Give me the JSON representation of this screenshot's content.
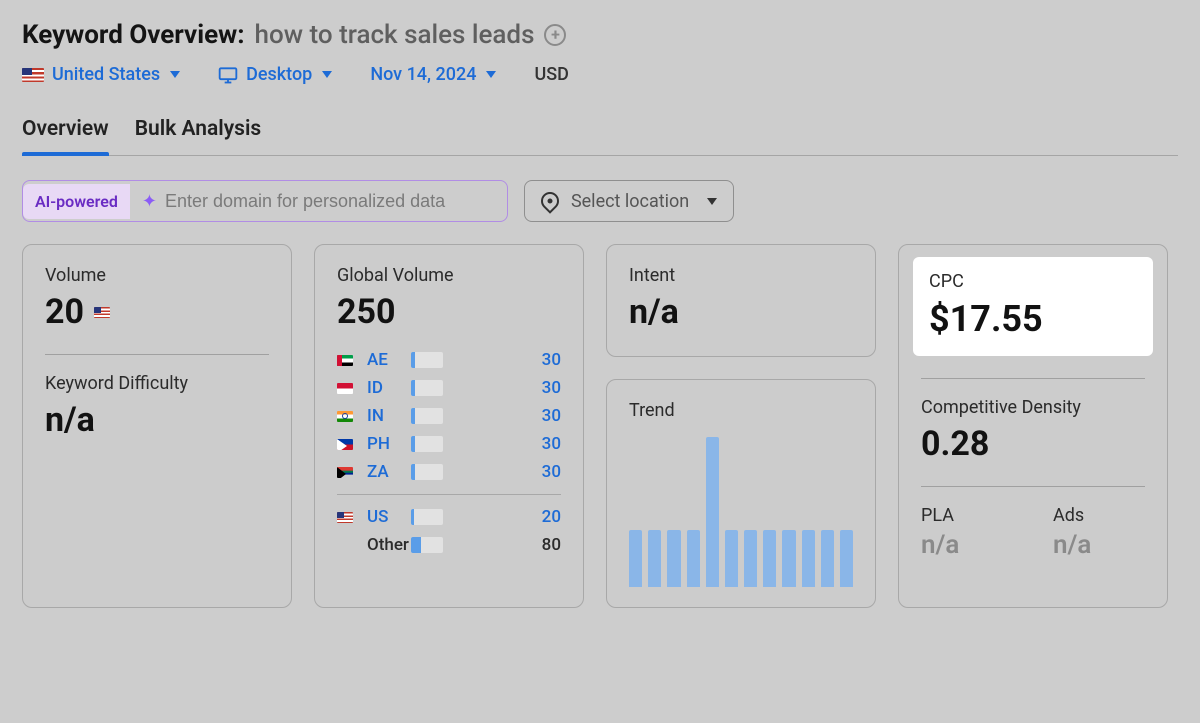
{
  "header": {
    "title_prefix": "Keyword Overview:",
    "keyword": "how to track sales leads"
  },
  "filters": {
    "country": "United States",
    "device": "Desktop",
    "date": "Nov 14, 2024",
    "currency": "USD"
  },
  "tabs": {
    "overview": "Overview",
    "bulk": "Bulk Analysis"
  },
  "controls": {
    "ai_badge": "AI-powered",
    "domain_placeholder": "Enter domain for personalized data",
    "location_placeholder": "Select location"
  },
  "cards": {
    "volume": {
      "label": "Volume",
      "value": "20"
    },
    "kd": {
      "label": "Keyword Difficulty",
      "value": "n/a"
    },
    "global_volume": {
      "label": "Global Volume",
      "value": "250",
      "rows": [
        {
          "flag": "ae",
          "code": "AE",
          "value": "30",
          "pct": 12
        },
        {
          "flag": "id",
          "code": "ID",
          "value": "30",
          "pct": 12
        },
        {
          "flag": "in",
          "code": "IN",
          "value": "30",
          "pct": 12
        },
        {
          "flag": "ph",
          "code": "PH",
          "value": "30",
          "pct": 12
        },
        {
          "flag": "za",
          "code": "ZA",
          "value": "30",
          "pct": 12
        }
      ],
      "us": {
        "flag": "us",
        "code": "US",
        "value": "20",
        "pct": 8
      },
      "other": {
        "code": "Other",
        "value": "80",
        "pct": 32
      }
    },
    "intent": {
      "label": "Intent",
      "value": "n/a"
    },
    "trend": {
      "label": "Trend"
    },
    "cpc": {
      "label": "CPC",
      "value": "$17.55"
    },
    "competitive": {
      "label": "Competitive Density",
      "value": "0.28"
    },
    "pla": {
      "label": "PLA",
      "value": "n/a"
    },
    "ads": {
      "label": "Ads",
      "value": "n/a"
    }
  },
  "chart_data": {
    "type": "bar",
    "title": "Trend",
    "xlabel": "",
    "ylabel": "",
    "categories": [
      "1",
      "2",
      "3",
      "4",
      "5",
      "6",
      "7",
      "8",
      "9",
      "10",
      "11",
      "12"
    ],
    "values": [
      38,
      38,
      38,
      38,
      100,
      38,
      38,
      38,
      38,
      38,
      38,
      38
    ],
    "ylim": [
      0,
      100
    ]
  }
}
